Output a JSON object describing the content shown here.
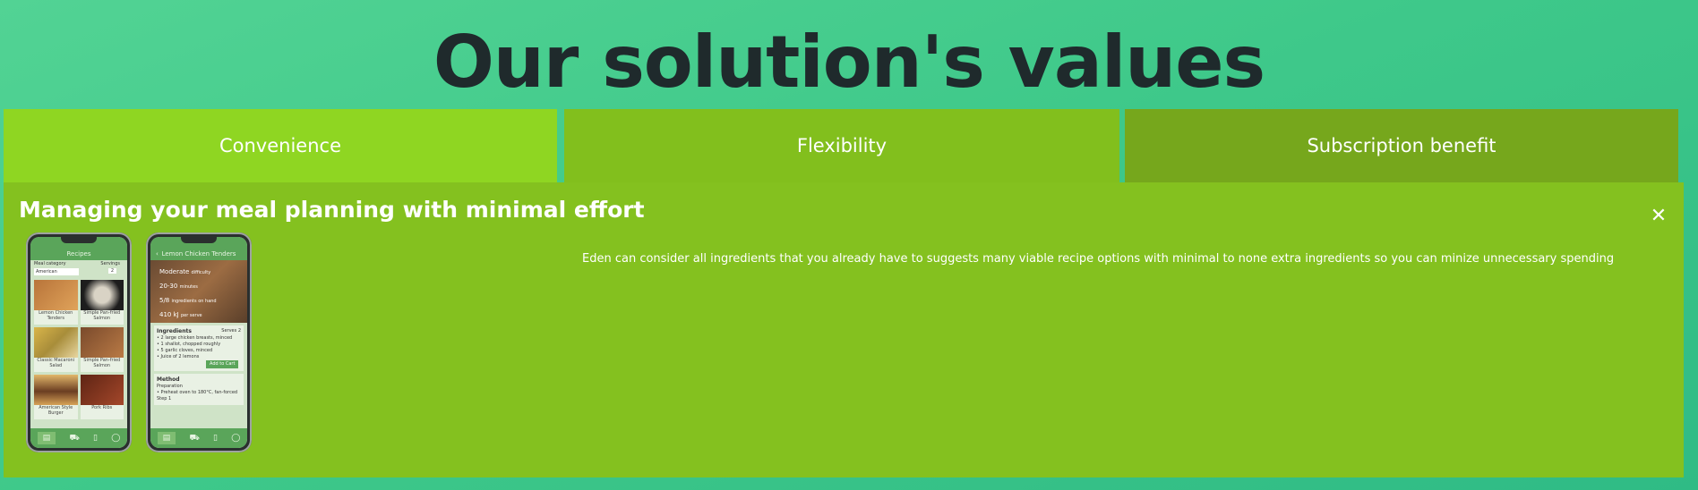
{
  "page": {
    "heading": "Our solution's values"
  },
  "tabs": [
    {
      "label": "Convenience",
      "color": "#8fd622"
    },
    {
      "label": "Flexibility",
      "color": "#82bf1d"
    },
    {
      "label": "Subscription benefit",
      "color": "#76a71c"
    }
  ],
  "panel": {
    "title": "Managing your meal planning with minimal effort",
    "description": "Eden can consider all ingredients that you already have to suggests many viable recipe options with minimal to none extra ingredients so you can minize unnecessary spending",
    "close_icon": "close-icon",
    "background": "#84c11f"
  },
  "phone_left": {
    "title": "Recipes",
    "filter_category_label": "Meal category",
    "filter_servings_label": "Servings",
    "filter_selected": "American",
    "servings_value": "2",
    "recipes": [
      "Lemon Chicken Tenders",
      "Simple Pan-fried Salmon",
      "Classic Macaroni Salad",
      "Simple Pan-fried Salmon",
      "American Style Burger",
      "Pork Ribs"
    ]
  },
  "phone_right": {
    "title": "Lemon Chicken Tenders",
    "difficulty": "Moderate",
    "difficulty_label": "difficulty",
    "time": "20-30",
    "time_unit": "minutes",
    "ingredients_count": "5/8",
    "ingredients_count_label": "ingredients on hand",
    "energy": "410 kJ",
    "energy_unit": "per serve",
    "ingredients_heading": "Ingredients",
    "serves_label": "Serves",
    "serves_value": "2",
    "ingredients": [
      "2 large chicken breasts, minced",
      "1 shallot, chopped roughly",
      "5 garlic cloves, minced",
      "Juice of 2 lemons"
    ],
    "add_to_cart": "Add to Cart",
    "method_heading": "Method",
    "preparation_heading": "Preparation",
    "preparation_step": "Preheat oven to 180°C, fan-forced",
    "step_label": "Step 1"
  }
}
